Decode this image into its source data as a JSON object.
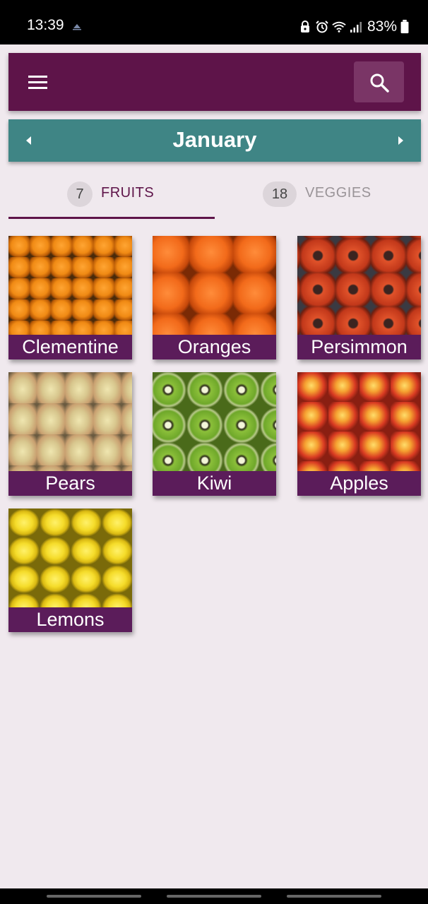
{
  "status_bar": {
    "time": "13:39",
    "battery_percent": "83%",
    "icons": [
      "notification-icon",
      "lock-icon",
      "alarm-icon",
      "wifi-icon",
      "signal-icon",
      "battery-icon"
    ]
  },
  "app_bar": {
    "menu_icon": "hamburger-menu-icon",
    "search_icon": "search-icon",
    "background_color": "#5e1449"
  },
  "month_selector": {
    "month": "January",
    "prev_icon": "chevron-left-icon",
    "next_icon": "chevron-right-icon",
    "background_color": "#3f8585"
  },
  "tabs": [
    {
      "count": "7",
      "label": "FRUITS",
      "selected": true
    },
    {
      "count": "18",
      "label": "VEGGIES",
      "selected": false
    }
  ],
  "produce": [
    {
      "name": "Clementine"
    },
    {
      "name": "Oranges"
    },
    {
      "name": "Persimmon"
    },
    {
      "name": "Pears"
    },
    {
      "name": "Kiwi"
    },
    {
      "name": "Apples"
    },
    {
      "name": "Lemons"
    }
  ],
  "colors": {
    "accent": "#5e1449",
    "card_label_bg": "#5b1c5a",
    "page_bg": "#f0e9ee"
  }
}
